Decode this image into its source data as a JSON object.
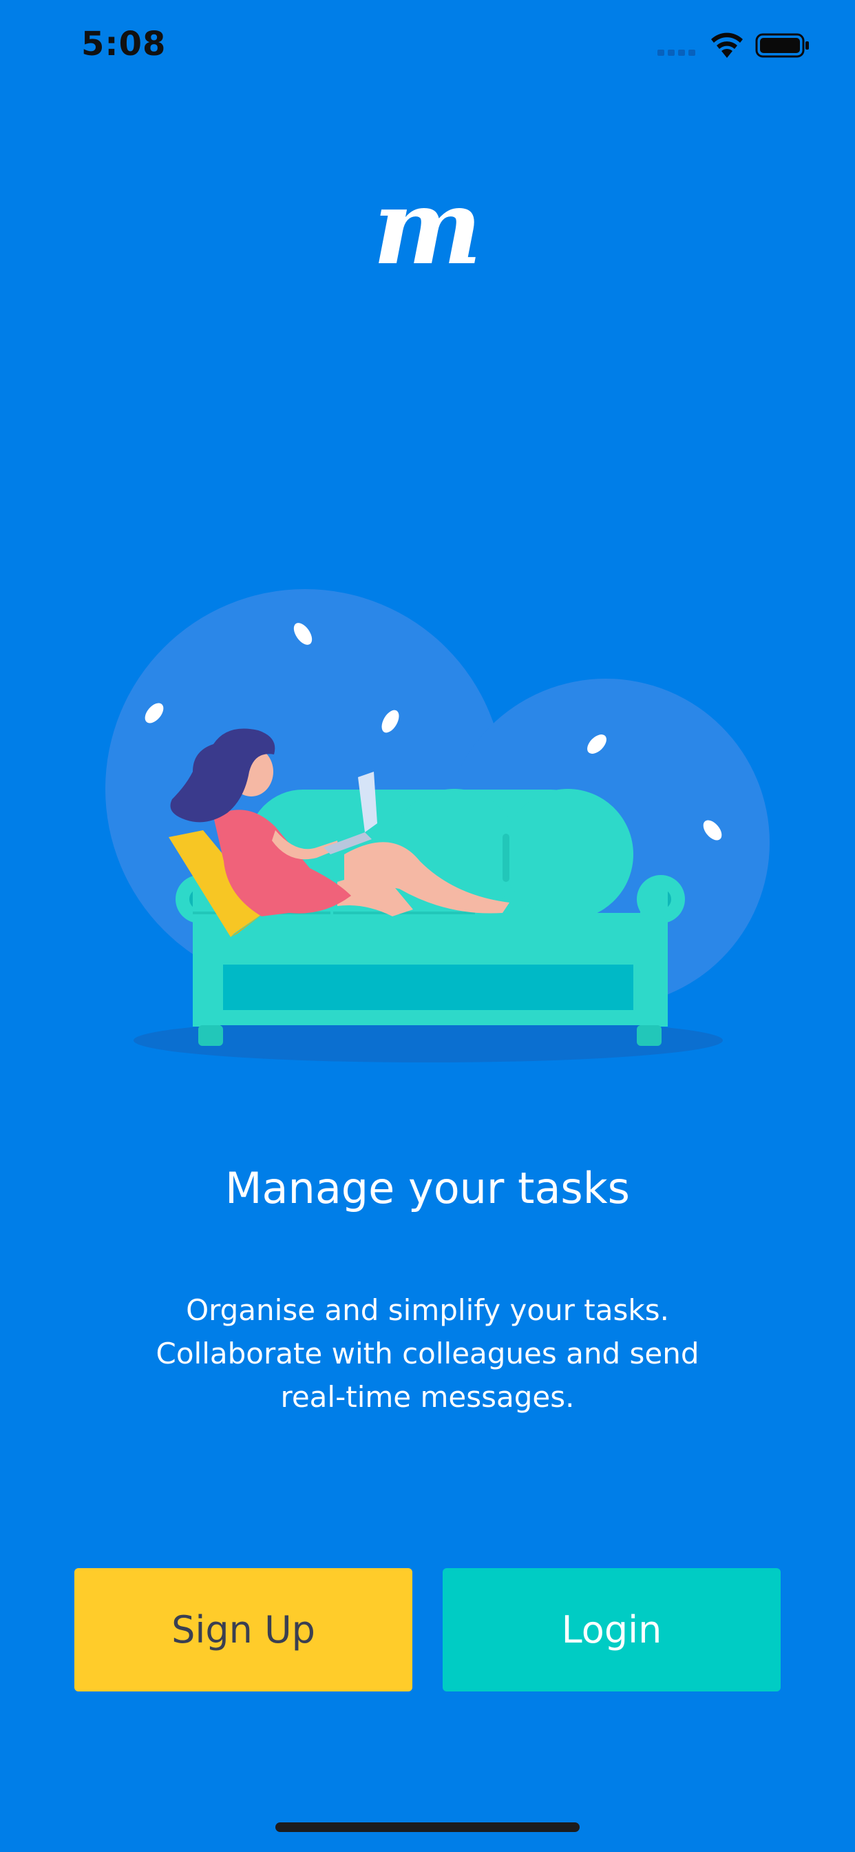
{
  "status_bar": {
    "time": "5:08"
  },
  "logo": {
    "glyph": "m"
  },
  "onboarding": {
    "headline": "Manage your tasks",
    "description_lines": [
      "Organise and simplify your tasks.",
      "Collaborate with colleagues and send",
      "real-time messages."
    ]
  },
  "actions": {
    "signup_label": "Sign Up",
    "login_label": "Login"
  },
  "colors": {
    "background": "#007EE8",
    "signup_button": "#FFCC2A",
    "login_button": "#00CCC4"
  },
  "icons": [
    "signal-icon",
    "wifi-icon",
    "battery-icon",
    "illustration-woman-on-sofa"
  ]
}
